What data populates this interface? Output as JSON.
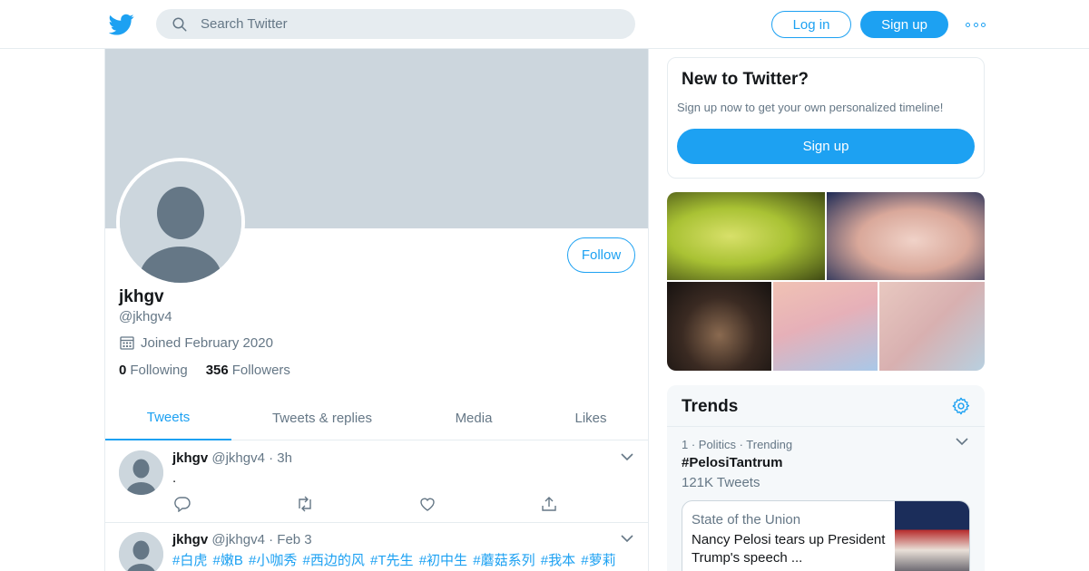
{
  "header": {
    "search_placeholder": "Search Twitter",
    "login_label": "Log in",
    "signup_label": "Sign up"
  },
  "profile": {
    "name": "jkhgv",
    "handle": "@jkhgv4",
    "joined": "Joined February 2020",
    "following_count": "0",
    "following_label": "Following",
    "followers_count": "356",
    "followers_label": "Followers",
    "follow_label": "Follow"
  },
  "tabs": [
    {
      "label": "Tweets",
      "active": true
    },
    {
      "label": "Tweets & replies",
      "active": false
    },
    {
      "label": "Media",
      "active": false
    },
    {
      "label": "Likes",
      "active": false
    }
  ],
  "tweets": [
    {
      "name": "jkhgv",
      "handle": "@jkhgv4",
      "time": "3h",
      "text": "."
    },
    {
      "name": "jkhgv",
      "handle": "@jkhgv4",
      "time": "Feb 3",
      "text": "#白虎 #嫩B #小咖秀 #西边的风 #T先生 #初中生 #蘑菇系列 #我本 #萝莉"
    }
  ],
  "signup_card": {
    "title": "New to Twitter?",
    "subtitle": "Sign up now to get your own personalized timeline!",
    "button_label": "Sign up"
  },
  "trends": {
    "title": "Trends",
    "items": [
      {
        "meta": "1 · Politics · Trending",
        "name": "#PelosiTantrum",
        "count": "121K Tweets"
      }
    ],
    "news": {
      "source": "State of the Union",
      "title": "Nancy Pelosi tears up President Trump's speech ..."
    }
  },
  "colors": {
    "accent": "#1da1f2",
    "banner": "#ccd6dd",
    "text_secondary": "#657786",
    "border": "#e6ecf0"
  }
}
